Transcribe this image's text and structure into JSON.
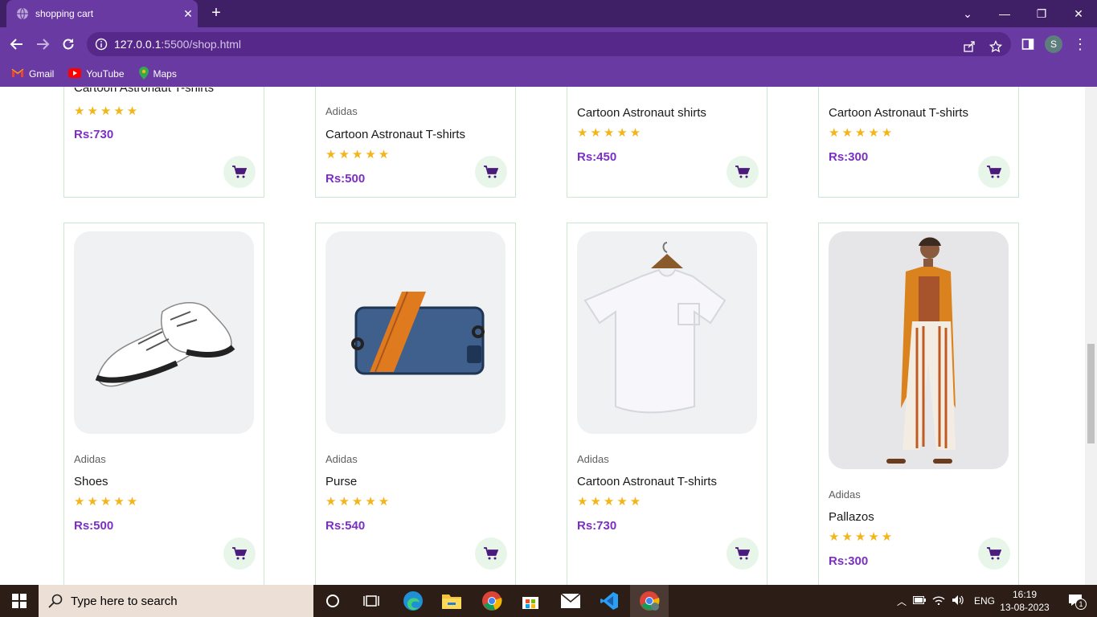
{
  "browser": {
    "tab_title": "shopping cart",
    "url_host": "127.0.0.1",
    "url_path": ":5500/shop.html",
    "profile_initial": "S",
    "bookmarks": [
      {
        "label": "Gmail",
        "icon": "gmail-icon"
      },
      {
        "label": "YouTube",
        "icon": "youtube-icon"
      },
      {
        "label": "Maps",
        "icon": "maps-icon"
      }
    ]
  },
  "products_top": [
    {
      "brand": "",
      "name": "Cartoon Astronaut T-shirts",
      "price": "Rs:730",
      "rating": 5
    },
    {
      "brand": "Adidas",
      "name": "Cartoon Astronaut T-shirts",
      "price": "Rs:500",
      "rating": 5
    },
    {
      "brand": "",
      "name": "Cartoon Astronaut shirts",
      "price": "Rs:450",
      "rating": 5
    },
    {
      "brand": "",
      "name": "Cartoon Astronaut T-shirts",
      "price": "Rs:300",
      "rating": 5
    }
  ],
  "products_bottom": [
    {
      "brand": "Adidas",
      "name": "Shoes",
      "price": "Rs:500",
      "rating": 5,
      "image": "shoes-image"
    },
    {
      "brand": "Adidas",
      "name": "Purse",
      "price": "Rs:540",
      "rating": 5,
      "image": "purse-image"
    },
    {
      "brand": "Adidas",
      "name": "Cartoon Astronaut T-shirts",
      "price": "Rs:730",
      "rating": 5,
      "image": "tshirt-image"
    },
    {
      "brand": "Adidas",
      "name": "Pallazos",
      "price": "Rs:300",
      "rating": 5,
      "image": "pallazos-image"
    }
  ],
  "stars_text": "★★★★★",
  "taskbar": {
    "search_placeholder": "Type here to search",
    "language": "ENG",
    "time": "16:19",
    "date": "13-08-2023",
    "notification_count": "1"
  },
  "colors": {
    "accent": "#6a3aa3",
    "price": "#7b2fc4",
    "star": "#f3b519",
    "cart_bg": "#e8f6ea"
  }
}
